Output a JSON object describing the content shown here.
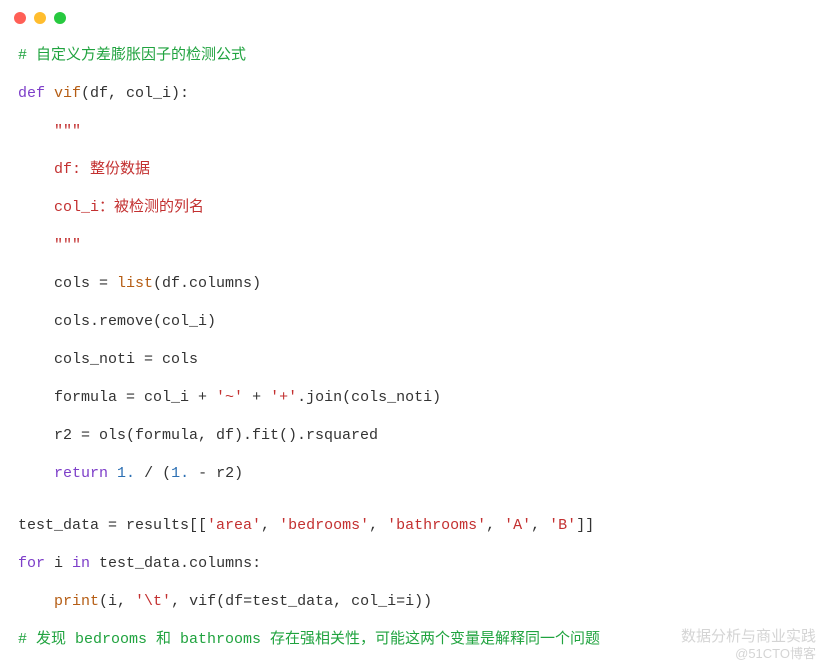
{
  "window": {
    "controls": [
      "red",
      "yellow",
      "green"
    ]
  },
  "code": {
    "l01": "# 自定义方差膨胀因子的检测公式",
    "l02_def": "def",
    "l02_name": " vif",
    "l02_rest": "(df, col_i):",
    "l03": "    ",
    "l03_q": "\"\"\"",
    "l04": "    df: 整份数据",
    "l05": "    col_i：被检测的列名",
    "l06": "    ",
    "l06_q": "\"\"\"",
    "l07a": "    cols = ",
    "l07b": "list",
    "l07c": "(df.columns)",
    "l08": "    cols.remove(col_i)",
    "l09": "    cols_noti = cols",
    "l10a": "    formula = col_i + ",
    "l10b": "'~'",
    "l10c": " + ",
    "l10d": "'+'",
    "l10e": ".join(cols_noti)",
    "l11": "    r2 = ols(formula, df).fit().rsquared",
    "l12a": "    ",
    "l12_ret": "return",
    "l12b": " ",
    "l12n1": "1.",
    "l12c": " / (",
    "l12n2": "1.",
    "l12d": " - r2)",
    "l13a": "test_data = results[[",
    "l13s1": "'area'",
    "l13c1": ", ",
    "l13s2": "'bedrooms'",
    "l13c2": ", ",
    "l13s3": "'bathrooms'",
    "l13c3": ", ",
    "l13s4": "'A'",
    "l13c4": ", ",
    "l13s5": "'B'",
    "l13e": "]]",
    "l14_for": "for",
    "l14_a": " i ",
    "l14_in": "in",
    "l14_b": " test_data.columns:",
    "l15a": "    ",
    "l15p": "print",
    "l15b": "(i, ",
    "l15s": "'\\t'",
    "l15c": ", vif(df=test_data, col_i=i))",
    "l16": "# 发现 bedrooms 和 bathrooms 存在强相关性，可能这两个变量是解释同一个问题"
  },
  "watermark": {
    "line1": "数据分析与商业实践",
    "line2": "@51CTO博客"
  }
}
